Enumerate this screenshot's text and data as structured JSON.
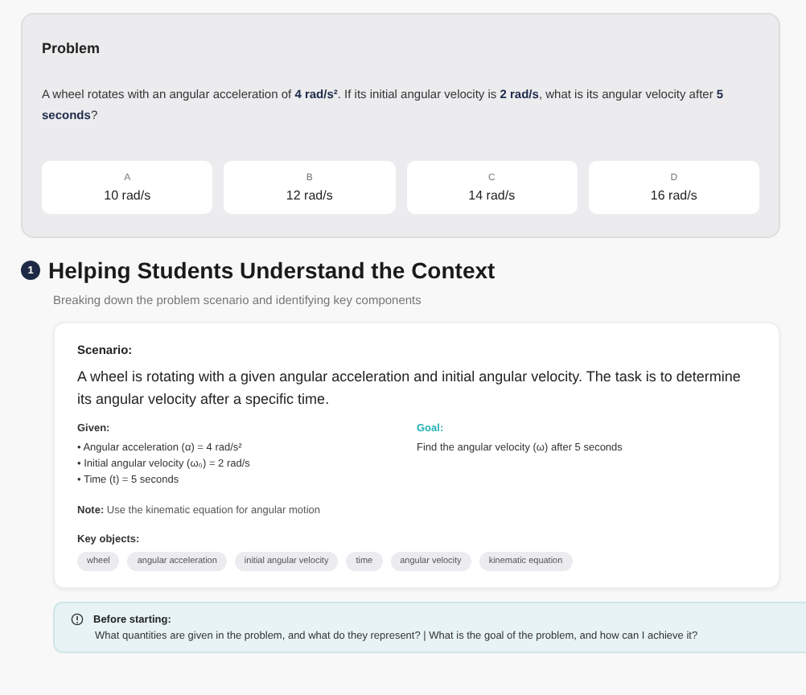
{
  "problem": {
    "title": "Problem",
    "text": "A wheel rotates with an angular acceleration of **4 rad/s²**. If its initial angular velocity is **2 rad/s**, what is its angular velocity after **5 seconds**?",
    "options": [
      {
        "letter": "A",
        "value": "10 rad/s"
      },
      {
        "letter": "B",
        "value": "12 rad/s"
      },
      {
        "letter": "C",
        "value": "14 rad/s"
      },
      {
        "letter": "D",
        "value": "16 rad/s"
      }
    ]
  },
  "section": {
    "number": "1",
    "title": "Helping Students Understand the Context",
    "subtitle": "Breaking down the problem scenario and identifying key components",
    "scenario_label": "Scenario:",
    "scenario": "A wheel is rotating with a given angular acceleration and initial angular velocity. The task is to determine its angular velocity after a specific time.",
    "given_label": "Given:",
    "given": [
      "• Angular acceleration (α) = 4 rad/s²",
      "• Initial angular velocity (ω₀) = 2 rad/s",
      "• Time (t) = 5 seconds"
    ],
    "goal_label": "Goal:",
    "goal": "Find the angular velocity (ω) after 5 seconds",
    "note": "**Note:** Use the kinematic equation for angular motion",
    "key_label": "Key objects:",
    "key_objects": [
      "wheel",
      "angular acceleration",
      "initial angular velocity",
      "time",
      "angular velocity",
      "kinematic equation"
    ],
    "hint_title": "Before starting:",
    "hint": "What quantities are given in the problem, and what do they represent? | What is the goal of the problem, and how can I achieve it?"
  }
}
